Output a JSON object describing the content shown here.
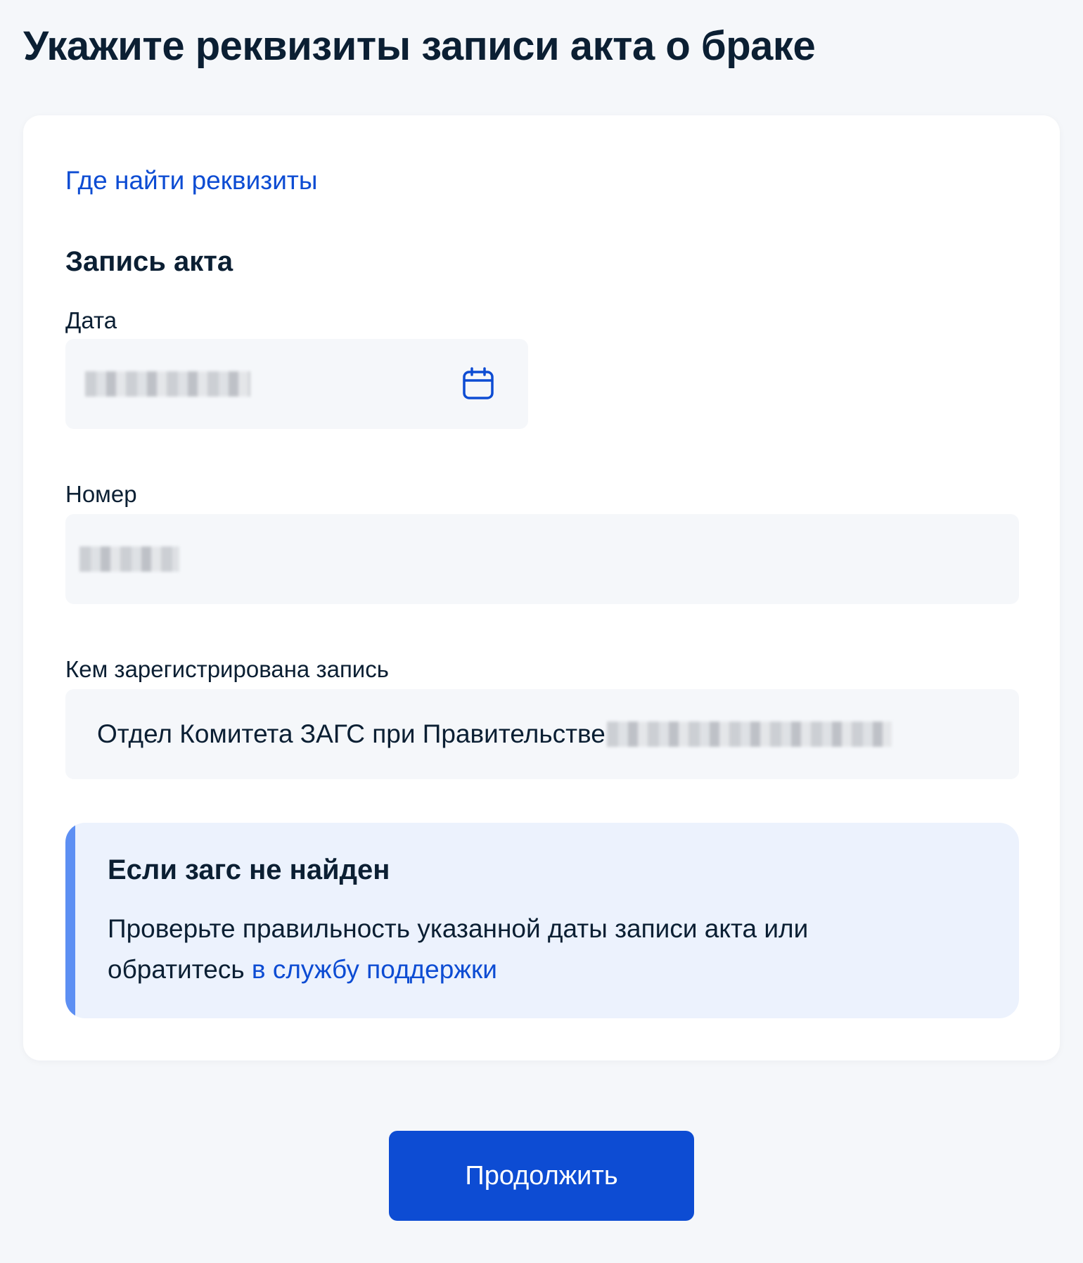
{
  "page": {
    "title": "Укажите реквизиты записи акта о браке"
  },
  "form": {
    "help_link": "Где найти реквизиты",
    "section_title": "Запись акта",
    "date": {
      "label": "Дата",
      "value_redacted": true,
      "icon": "calendar-icon"
    },
    "number": {
      "label": "Номер",
      "value_redacted": true
    },
    "registrar": {
      "label": "Кем зарегистрирована запись",
      "value": "Отдел Комитета ЗАГС при Правительстве",
      "value_tail_redacted": true
    }
  },
  "notice": {
    "title": "Если загс не найден",
    "text_before_link": "Проверьте правильность указанной даты записи акта или обратитесь ",
    "link": "в службу поддержки",
    "accent_color": "#5d8ff3",
    "background_color": "#ecf2fd"
  },
  "actions": {
    "continue_label": "Продолжить"
  },
  "colors": {
    "primary": "#0d4cd3",
    "text": "#0b1f33",
    "page_background": "#f5f7fa",
    "field_background": "#f5f7fa"
  }
}
